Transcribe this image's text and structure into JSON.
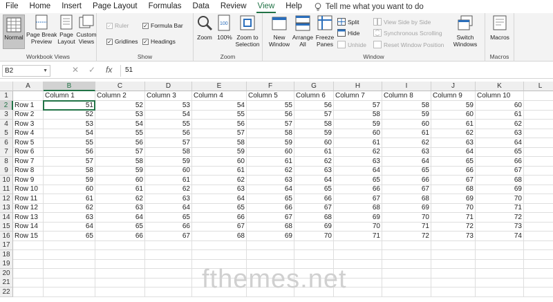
{
  "menu": {
    "tabs": [
      "File",
      "Home",
      "Insert",
      "Page Layout",
      "Formulas",
      "Data",
      "Review",
      "View",
      "Help"
    ],
    "active": "View",
    "tell_me": "Tell me what you want to do"
  },
  "ribbon": {
    "workbook_views": {
      "title": "Workbook Views",
      "normal": "Normal",
      "page_break": "Page Break\nPreview",
      "page_layout": "Page\nLayout",
      "custom_views": "Custom\nViews"
    },
    "show": {
      "title": "Show",
      "ruler": "Ruler",
      "formula_bar": "Formula Bar",
      "gridlines": "Gridlines",
      "headings": "Headings"
    },
    "zoom": {
      "title": "Zoom",
      "zoom": "Zoom",
      "hundred": "100%",
      "zoom_sel": "Zoom to\nSelection"
    },
    "window": {
      "title": "Window",
      "new_window": "New\nWindow",
      "arrange_all": "Arrange\nAll",
      "freeze": "Freeze\nPanes",
      "split": "Split",
      "hide": "Hide",
      "unhide": "Unhide",
      "side_by_side": "View Side by Side",
      "sync_scroll": "Synchronous Scrolling",
      "reset_pos": "Reset Window Position",
      "switch": "Switch\nWindows"
    },
    "macros": {
      "title": "Macros",
      "macros": "Macros"
    }
  },
  "formula_bar": {
    "name_box": "B2",
    "cancel": "✕",
    "enter": "✓",
    "fx": "fx",
    "content": "51"
  },
  "sheet": {
    "col_headers": [
      "A",
      "B",
      "C",
      "D",
      "E",
      "F",
      "G",
      "H",
      "I",
      "J",
      "K",
      "L"
    ],
    "row_headers": [
      "1",
      "2",
      "3",
      "4",
      "5",
      "6",
      "7",
      "8",
      "9",
      "10",
      "11",
      "12",
      "13",
      "14",
      "15",
      "16",
      "17",
      "18",
      "19",
      "20",
      "21",
      "22"
    ],
    "header_row": [
      "",
      "Column 1",
      "Column 2",
      "Column 3",
      "Column 4",
      "Column 5",
      "Column 6",
      "Column 7",
      "Column 8",
      "Column 9",
      "Column 10"
    ],
    "row_labels": [
      "Row 1",
      "Row 2",
      "Row 3",
      "Row 4",
      "Row 5",
      "Row 6",
      "Row 7",
      "Row 8",
      "Row 9",
      "Row 10",
      "Row 11",
      "Row 12",
      "Row 13",
      "Row 14",
      "Row 15"
    ],
    "values": [
      [
        51,
        52,
        53,
        54,
        55,
        56,
        57,
        58,
        59,
        60
      ],
      [
        52,
        53,
        54,
        55,
        56,
        57,
        58,
        59,
        60,
        61
      ],
      [
        53,
        54,
        55,
        56,
        57,
        58,
        59,
        60,
        61,
        62
      ],
      [
        54,
        55,
        56,
        57,
        58,
        59,
        60,
        61,
        62,
        63
      ],
      [
        55,
        56,
        57,
        58,
        59,
        60,
        61,
        62,
        63,
        64
      ],
      [
        56,
        57,
        58,
        59,
        60,
        61,
        62,
        63,
        64,
        65
      ],
      [
        57,
        58,
        59,
        60,
        61,
        62,
        63,
        64,
        65,
        66
      ],
      [
        58,
        59,
        60,
        61,
        62,
        63,
        64,
        65,
        66,
        67
      ],
      [
        59,
        60,
        61,
        62,
        63,
        64,
        65,
        66,
        67,
        68
      ],
      [
        60,
        61,
        62,
        63,
        64,
        65,
        66,
        67,
        68,
        69
      ],
      [
        61,
        62,
        63,
        64,
        65,
        66,
        67,
        68,
        69,
        70
      ],
      [
        62,
        63,
        64,
        65,
        66,
        67,
        68,
        69,
        70,
        71
      ],
      [
        63,
        64,
        65,
        66,
        67,
        68,
        69,
        70,
        71,
        72
      ],
      [
        64,
        65,
        66,
        67,
        68,
        69,
        70,
        71,
        72,
        73
      ],
      [
        65,
        66,
        67,
        68,
        69,
        70,
        71,
        72,
        73,
        74
      ]
    ],
    "selected_col": "B",
    "selected_row": "2"
  },
  "watermark": "fthemes.net",
  "colors": {
    "accent": "#217346"
  }
}
